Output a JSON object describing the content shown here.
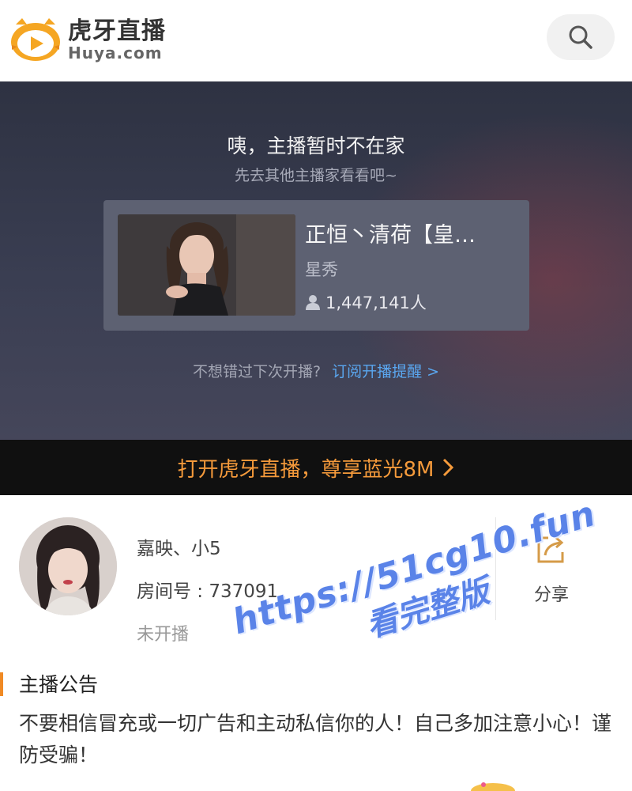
{
  "header": {
    "logo_cn": "虎牙直播",
    "logo_en": "Huya.com",
    "search_icon": "search-icon"
  },
  "hero": {
    "title": "咦，主播暂时不在家",
    "subtitle": "先去其他主播家看看吧~",
    "recommend": {
      "name": "正恒丶清荷【皇…",
      "category": "星秀",
      "viewers": "1,447,141人"
    },
    "subscribe_question": "不想错过下次开播?",
    "subscribe_link": "订阅开播提醒 >"
  },
  "banner": {
    "text": "打开虎牙直播，尊享蓝光8M",
    "chevron_icon": "chevron-right-icon",
    "color": "#f59a3b"
  },
  "anchor": {
    "name": "嘉映、小5",
    "room": "房间号 : 737091",
    "status": "未开播",
    "share_label": "分享"
  },
  "notice": {
    "title": "主播公告",
    "body": "不要相信冒充或一切广告和主动私信你的人！自己多加注意小心！谨防受骗！"
  },
  "watermark": {
    "line1": "https://51cg10.fun",
    "line2": "看完整版",
    "color": "#5a83e8"
  },
  "colors": {
    "accent_orange": "#f08a24",
    "link_blue": "#5aa7f0",
    "hero_bg": "#353949"
  }
}
